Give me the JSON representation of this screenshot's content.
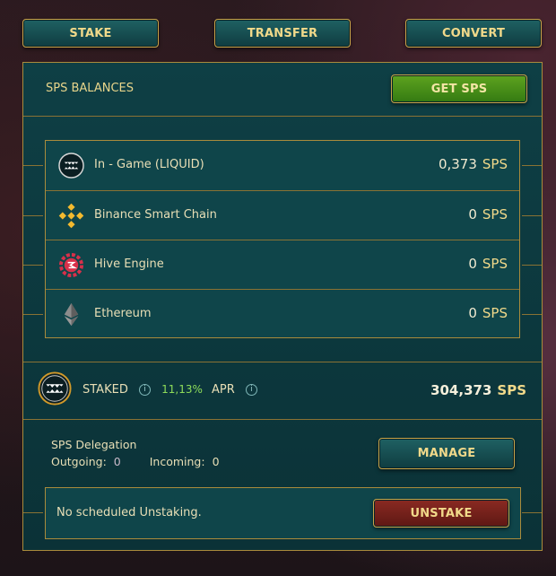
{
  "top_buttons": {
    "stake": "STAKE",
    "transfer": "TRANSFER",
    "convert": "CONVERT"
  },
  "header": {
    "title": "SPS BALANCES",
    "get_sps": "GET SPS"
  },
  "balances": [
    {
      "label": "In - Game (LIQUID)",
      "amount": "0,373",
      "unit": "SPS",
      "icon": "splinterlands-icon"
    },
    {
      "label": "Binance Smart Chain",
      "amount": "0",
      "unit": "SPS",
      "icon": "binance-icon"
    },
    {
      "label": "Hive Engine",
      "amount": "0",
      "unit": "SPS",
      "icon": "hive-engine-icon"
    },
    {
      "label": "Ethereum",
      "amount": "0",
      "unit": "SPS",
      "icon": "ethereum-icon"
    }
  ],
  "staked": {
    "label": "STAKED",
    "apr_value": "11,13%",
    "apr_label": "APR",
    "amount": "304,373",
    "unit": "SPS"
  },
  "delegation": {
    "title": "SPS Delegation",
    "outgoing_label": "Outgoing:",
    "outgoing_value": "0",
    "incoming_label": "Incoming:",
    "incoming_value": "0",
    "manage": "MANAGE"
  },
  "unstake": {
    "message": "No scheduled Unstaking.",
    "button": "UNSTAKE"
  },
  "colors": {
    "panel": "#0e3f45",
    "gold": "#c8a44a",
    "green_text": "#8fdc5a"
  }
}
